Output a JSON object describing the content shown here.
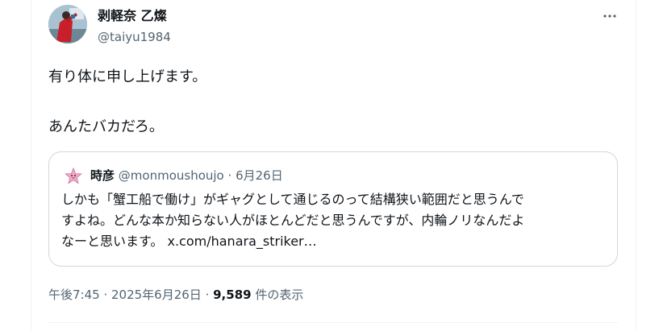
{
  "author": {
    "display_name": "剥軽奈 乙燦",
    "handle": "@taiyu1984"
  },
  "tweet": {
    "line1": "有り体に申し上げます。",
    "line2": "あんたバカだろ。"
  },
  "quote": {
    "display_name": "時彦",
    "handle": "@monmoushoujo",
    "separator": " · ",
    "date": "6月26日",
    "lines": [
      "しかも「蟹工船で働け」がギャグとして通じるのって結構狭い範囲だと思うんで",
      "すよね。どんな本か知らない人がほとんどだと思うんですが、内輪ノリなんだよ",
      "なーと思います。 x.com/hanara_striker…"
    ]
  },
  "meta": {
    "time": "午後7:45",
    "separator": " · ",
    "date": "2025年6月26日",
    "views_count": "9,589",
    "views_label": " 件の表示"
  },
  "icons": {
    "more": "more-icon"
  },
  "colors": {
    "text_primary": "#0f1419",
    "text_secondary": "#536471",
    "border": "#cfd9de"
  }
}
